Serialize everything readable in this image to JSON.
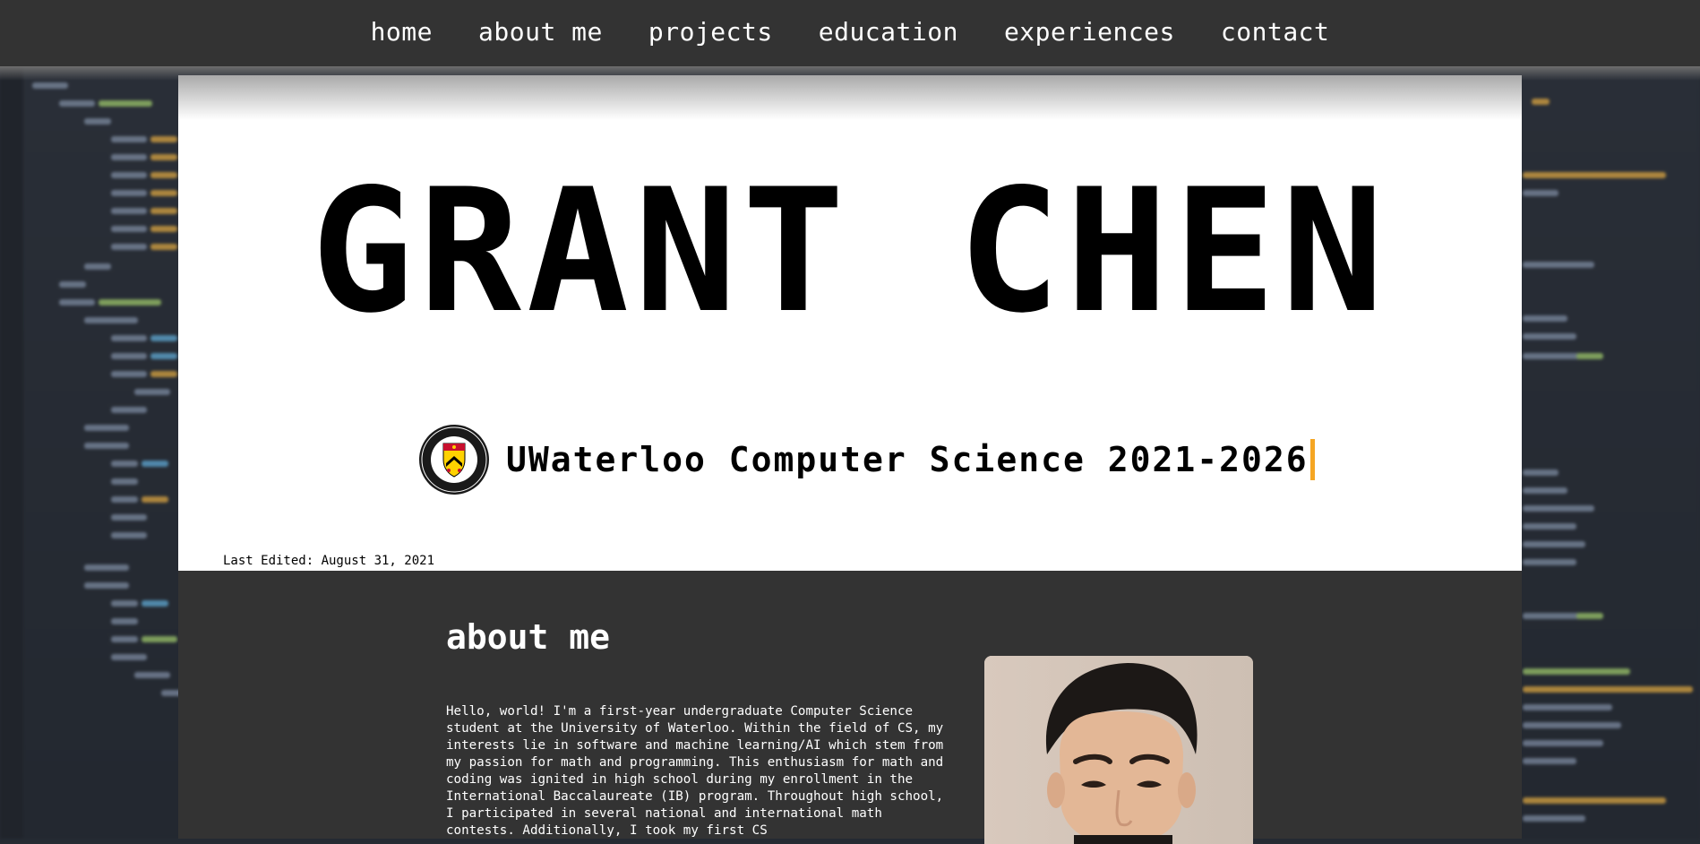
{
  "nav": {
    "items": [
      {
        "label": "home"
      },
      {
        "label": "about me"
      },
      {
        "label": "projects"
      },
      {
        "label": "education"
      },
      {
        "label": "experiences"
      },
      {
        "label": "contact"
      }
    ]
  },
  "hero": {
    "name": "GRANT  CHEN",
    "subtitle": "UWaterloo Computer Science 2021-2026",
    "logo_icon": "university-of-waterloo-crest-icon",
    "logo_text": "UNIVERSITY OF WATERLOO",
    "last_edited": "Last Edited: August 31, 2021"
  },
  "about": {
    "title": "about me",
    "text": "Hello, world! I'm a first-year undergraduate Computer Science student at the University of Waterloo. Within the field of CS, my interests lie in software and machine learning/AI which stem from my passion for math and programming. This enthusiasm for math and coding was ignited in high school during my enrollment in the International Baccalaureate (IB) program. Throughout high school, I participated in several national and international math contests. Additionally, I took my first CS"
  },
  "colors": {
    "nav_bg": "#333333",
    "accent_cursor": "#f5a623",
    "section_bg": "#333333",
    "hero_bg": "#ffffff"
  }
}
